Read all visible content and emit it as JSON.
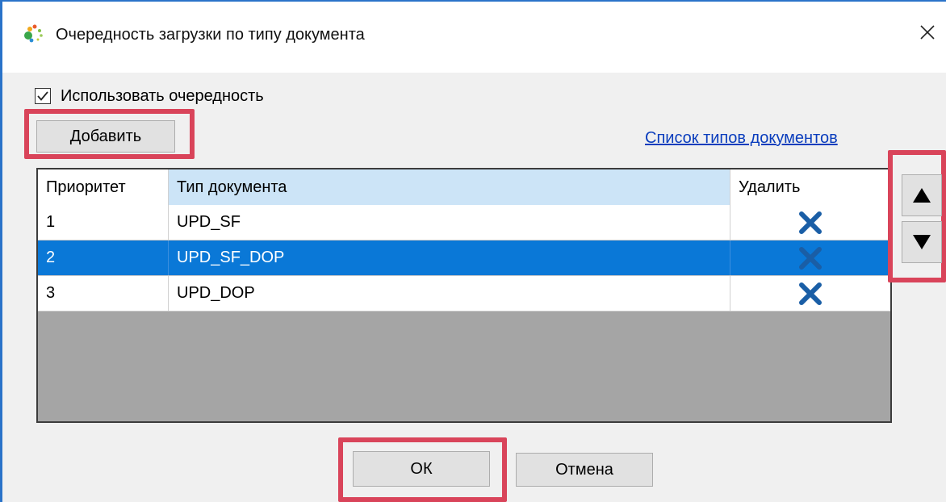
{
  "window": {
    "title": "Очередность загрузки по типу документа",
    "app_icon": "app-logo-icon",
    "close_icon": "close-icon"
  },
  "options": {
    "use_priority_label": "Использовать очередность",
    "use_priority_checked": true
  },
  "toolbar": {
    "add_label": "Добавить",
    "doc_types_link": "Список типов документов"
  },
  "table": {
    "columns": [
      "Приоритет",
      "Тип документа",
      "Удалить"
    ],
    "selected_column": 1,
    "rows": [
      {
        "priority": "1",
        "doc_type": "UPD_SF",
        "selected": false
      },
      {
        "priority": "2",
        "doc_type": "UPD_SF_DOP",
        "selected": true
      },
      {
        "priority": "3",
        "doc_type": "UPD_DOP",
        "selected": false
      }
    ],
    "delete_icon": "delete-x-icon"
  },
  "reorder": {
    "up_icon": "arrow-up-icon",
    "down_icon": "arrow-down-icon"
  },
  "footer": {
    "ok_label": "ОК",
    "cancel_label": "Отмена"
  },
  "colors": {
    "accent_blue": "#0a78d7",
    "header_selected": "#cce4f7",
    "highlight_red": "#d9445a",
    "delete_icon": "#1a5ea6",
    "link": "#0a3dbd"
  }
}
